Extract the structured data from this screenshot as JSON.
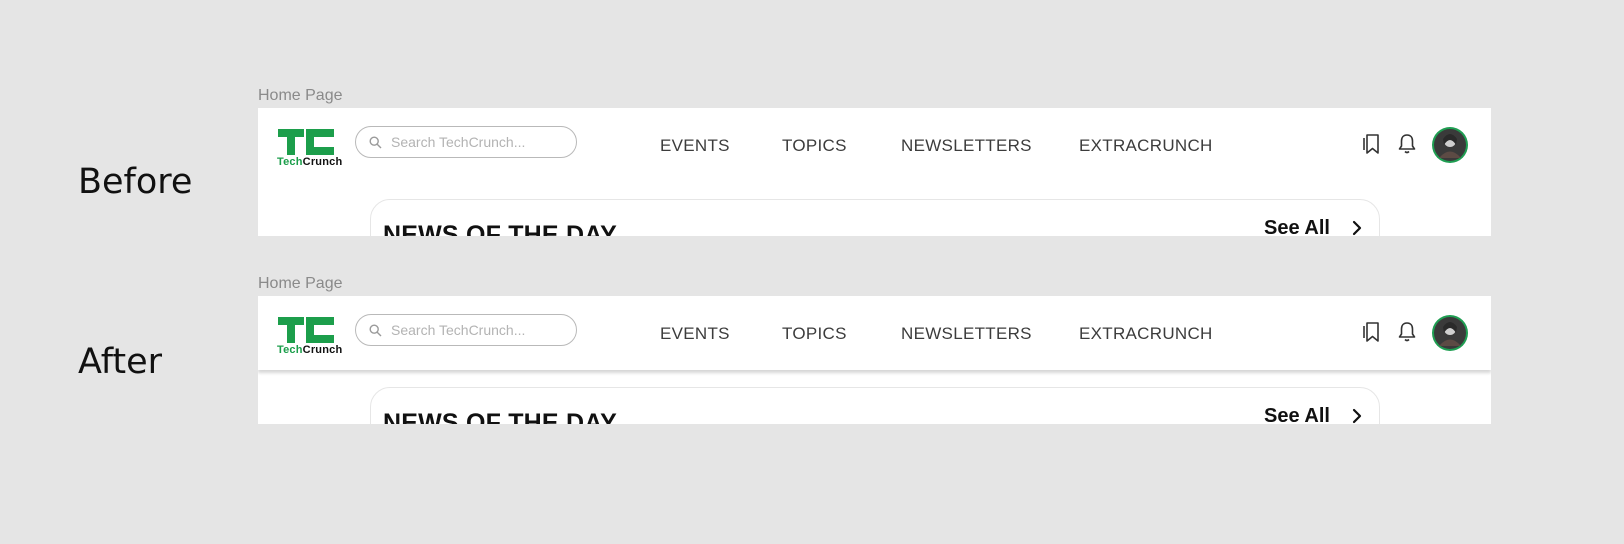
{
  "labels": {
    "before": "Before",
    "after": "After"
  },
  "frames": [
    {
      "title": "Home Page",
      "logo": {
        "part1": "Tech",
        "part2": "Crunch",
        "color": "#1c9e4b"
      },
      "search": {
        "placeholder": "Search TechCrunch...",
        "value": ""
      },
      "nav": [
        "EVENTS",
        "TOPICS",
        "NEWSLETTERS",
        "EXTRACRUNCH"
      ],
      "icons": [
        "bookmark-icon",
        "bell-icon",
        "avatar"
      ],
      "card": {
        "title": "NEWS OF THE DAY",
        "see_all": "See All"
      },
      "navbar_shadow": false
    },
    {
      "title": "Home Page",
      "logo": {
        "part1": "Tech",
        "part2": "Crunch",
        "color": "#1c9e4b"
      },
      "search": {
        "placeholder": "Search TechCrunch...",
        "value": ""
      },
      "nav": [
        "EVENTS",
        "TOPICS",
        "NEWSLETTERS",
        "EXTRACRUNCH"
      ],
      "icons": [
        "bookmark-icon",
        "bell-icon",
        "avatar"
      ],
      "card": {
        "title": "NEWS OF THE DAY",
        "see_all": "See All"
      },
      "navbar_shadow": true
    }
  ]
}
